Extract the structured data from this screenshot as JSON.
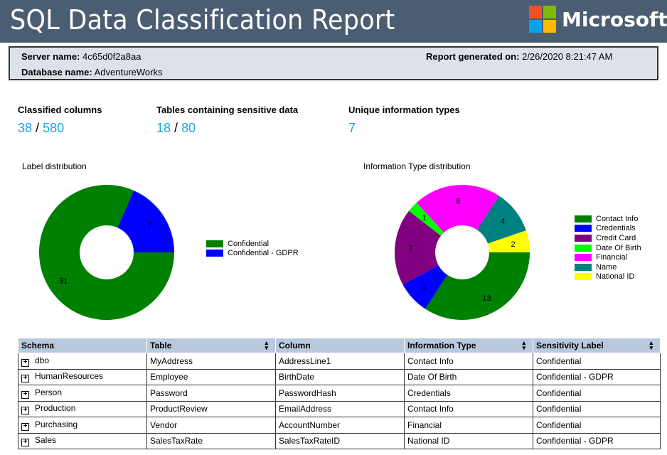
{
  "header": {
    "title": "SQL Data Classification Report",
    "brand": "Microsoft",
    "logo_colors": [
      "#f25022",
      "#7fba00",
      "#00a4ef",
      "#ffb900"
    ]
  },
  "info": {
    "server_label": "Server name:",
    "server_value": "4c65d0f2a8aa",
    "report_label": "Report generated on:",
    "report_value": "2/26/2020 8:21:47 AM",
    "database_label": "Database name:",
    "database_value": "AdventureWorks"
  },
  "stats": {
    "classified": {
      "label": "Classified columns",
      "value": "38",
      "total": "580",
      "slash": "/"
    },
    "tables": {
      "label": "Tables containing sensitive data",
      "value": "18",
      "total": "80",
      "slash": "/"
    },
    "types": {
      "label": "Unique information types",
      "value": "7"
    }
  },
  "chart_data": [
    {
      "type": "pie",
      "variant": "donut",
      "title": "Label distribution",
      "categories": [
        "Confidential",
        "Confidential - GDPR"
      ],
      "values": [
        31,
        7
      ],
      "colors": [
        "#008000",
        "#0000ff"
      ],
      "legend": "right"
    },
    {
      "type": "pie",
      "variant": "donut",
      "title": "Information Type distribution",
      "categories": [
        "Contact Info",
        "Credentials",
        "Credit Card",
        "Date Of Birth",
        "Financial",
        "Name",
        "National ID"
      ],
      "values": [
        13,
        3,
        7,
        1,
        8,
        4,
        2
      ],
      "colors": [
        "#008000",
        "#0000ff",
        "#800080",
        "#00ff00",
        "#ff00ff",
        "#008080",
        "#ffff00"
      ],
      "legend": "right"
    }
  ],
  "table": {
    "headers": [
      "Schema",
      "Table",
      "Column",
      "Information Type",
      "Sensitivity Label"
    ],
    "expand_glyph": "+",
    "rows": [
      [
        "dbo",
        "MyAddress",
        "AddressLine1",
        "Contact Info",
        "Confidential"
      ],
      [
        "HumanResources",
        "Employee",
        "BirthDate",
        "Date Of Birth",
        "Confidential - GDPR"
      ],
      [
        "Person",
        "Password",
        "PasswordHash",
        "Credentials",
        "Confidential"
      ],
      [
        "Production",
        "ProductReview",
        "EmailAddress",
        "Contact Info",
        "Confidential"
      ],
      [
        "Purchasing",
        "Vendor",
        "AccountNumber",
        "Financial",
        "Confidential"
      ],
      [
        "Sales",
        "SalesTaxRate",
        "SalesTaxRateID",
        "National ID",
        "Confidential - GDPR"
      ]
    ]
  }
}
